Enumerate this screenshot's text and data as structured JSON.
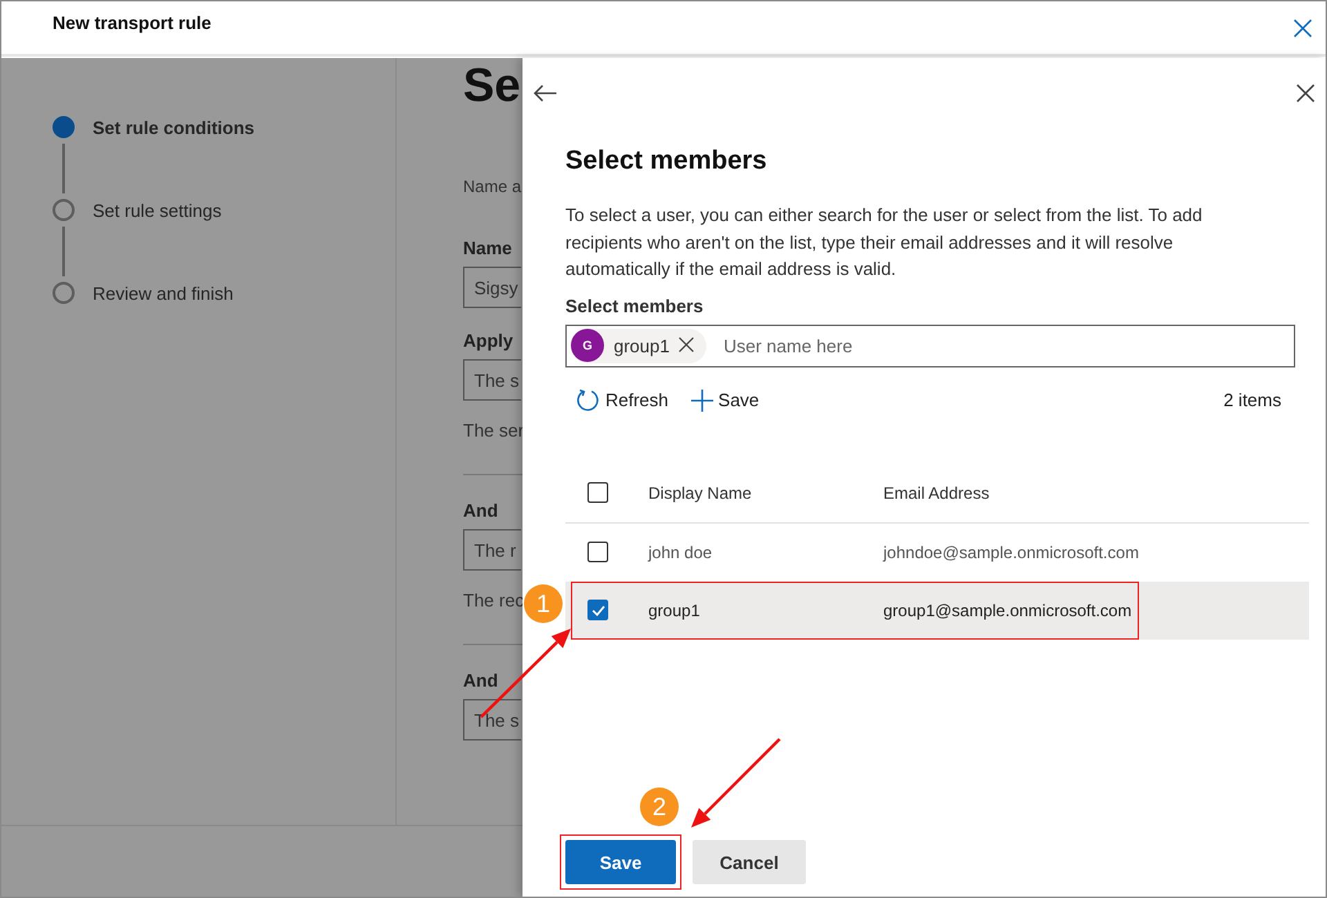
{
  "window": {
    "title": "New transport rule"
  },
  "steps": [
    {
      "label": "Set rule conditions",
      "selected": true
    },
    {
      "label": "Set rule settings",
      "selected": false
    },
    {
      "label": "Review and finish",
      "selected": false
    }
  ],
  "page": {
    "heading": "Se",
    "intro": "Name a",
    "sections": [
      {
        "kind": "field",
        "label": "Name",
        "value": "Sigsy"
      },
      {
        "kind": "field",
        "label": "Apply",
        "value": "The s",
        "note": "The ser"
      },
      {
        "kind": "condition",
        "label": "And",
        "value": "The r",
        "note": "The rec"
      },
      {
        "kind": "condition",
        "label": "And",
        "value": "The s"
      }
    ]
  },
  "panel": {
    "title": "Select members",
    "description": "To select a user, you can either search for the user or select from the list. To add recipients who aren't on the list, type their email addresses and it will resolve automatically if the email address is valid.",
    "field_label": "Select members",
    "chips": [
      {
        "initial": "G",
        "name": "group1"
      }
    ],
    "placeholder": "User name here",
    "toolbar": [
      {
        "kind": "refresh",
        "label": "Refresh"
      },
      {
        "kind": "add",
        "label": "Save"
      }
    ],
    "count": "2 items",
    "columns": [
      "Display Name",
      "Email Address"
    ],
    "header_checked": false,
    "rows": [
      {
        "name": "john doe",
        "email": "johndoe@sample.onmicrosoft.com",
        "selected": false
      },
      {
        "name": "group1",
        "email": "group1@sample.onmicrosoft.com",
        "selected": true
      }
    ],
    "buttons": [
      {
        "kind": "primary",
        "label": "Save"
      },
      {
        "kind": "secondary",
        "label": "Cancel"
      }
    ]
  },
  "annotations": [
    {
      "number": "1"
    },
    {
      "number": "2"
    }
  ]
}
